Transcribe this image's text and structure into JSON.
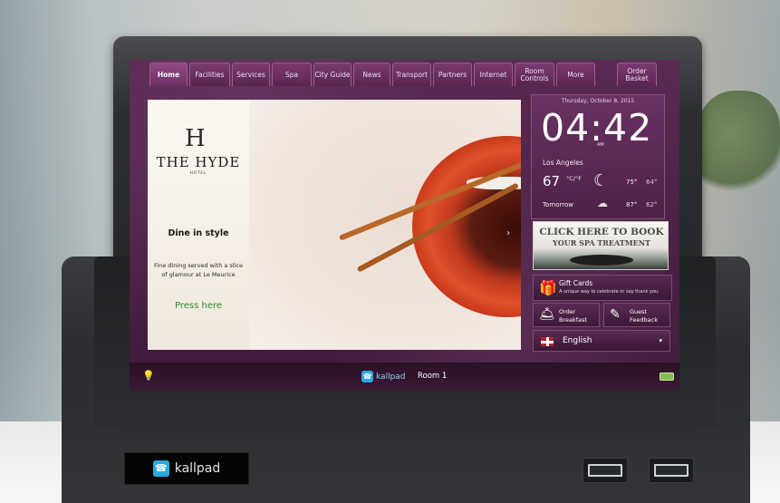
{
  "tabs": [
    {
      "label": "Home",
      "active": true
    },
    {
      "label": "Facilities"
    },
    {
      "label": "Services"
    },
    {
      "label": "Spa"
    },
    {
      "label": "City Guide"
    },
    {
      "label": "News"
    },
    {
      "label": "Transport"
    },
    {
      "label": "Partners"
    },
    {
      "label": "Internet"
    },
    {
      "label": "Room Controls"
    },
    {
      "label": "More"
    },
    {
      "label": "Order Basket"
    }
  ],
  "hero": {
    "logo_mark": "H",
    "title": "THE HYDE",
    "subtitle": "HOTEL",
    "headline": "Dine in style",
    "description": "Fine dining served with a slice of glamour at Le Meurice",
    "cta": "Press here",
    "next_arrow": "›"
  },
  "clock": {
    "date": "Thursday, October 8, 2015",
    "time": "04:42",
    "ampm": "AM",
    "city": "Los Angeles",
    "current_temp": "67",
    "units": "°C/°F",
    "today_high": "75°",
    "today_low": "64°",
    "tomorrow_label": "Tomorrow",
    "tomorrow_high": "87°",
    "tomorrow_low": "62°",
    "icons": {
      "today": "moon-icon",
      "tomorrow": "cloud-icon"
    }
  },
  "spa_banner": {
    "line1": "CLICK HERE TO BOOK",
    "line2": "YOUR SPA TREATMENT"
  },
  "gift_cards": {
    "title": "Gift Cards",
    "subtitle": "A unique way to celebrate or say thank you."
  },
  "buttons": {
    "order_breakfast": "Order Breakfast",
    "guest_feedback": "Guest Feedback"
  },
  "language": {
    "selected": "English",
    "caret": "▾"
  },
  "bottombar": {
    "brand": "kallpad",
    "room": "Room 1"
  },
  "device": {
    "brand": "kallpad"
  },
  "colors": {
    "tab_bg": "#7a3a6f",
    "screen_bg": "#3b1a34",
    "cta_green": "#2f8a2c",
    "brand_blue": "#2aa9e0"
  }
}
